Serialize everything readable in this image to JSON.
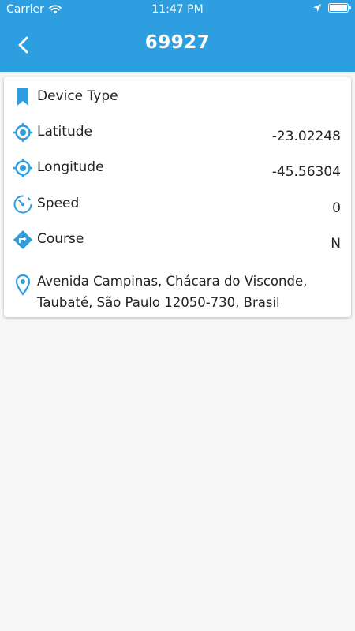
{
  "status_bar": {
    "carrier": "Carrier",
    "time": "11:47 PM"
  },
  "nav": {
    "title": "69927",
    "back_icon": "chevron-left-icon"
  },
  "colors": {
    "accent": "#2d9fe0",
    "background": "#f6f6f6"
  },
  "details": {
    "device_type": {
      "label": "Device Type",
      "icon": "bookmark-icon"
    },
    "latitude": {
      "label": "Latitude",
      "value": "-23.02248",
      "icon": "crosshair-icon"
    },
    "longitude": {
      "label": "Longitude",
      "value": "-45.56304",
      "icon": "crosshair-icon"
    },
    "speed": {
      "label": "Speed",
      "value": "0",
      "icon": "speedometer-icon"
    },
    "course": {
      "label": "Course",
      "value": "N",
      "icon": "direction-sign-icon"
    },
    "address": {
      "text": "Avenida Campinas, Chácara do Visconde, Taubaté, São Paulo 12050-730, Brasil",
      "icon": "map-pin-icon"
    }
  }
}
